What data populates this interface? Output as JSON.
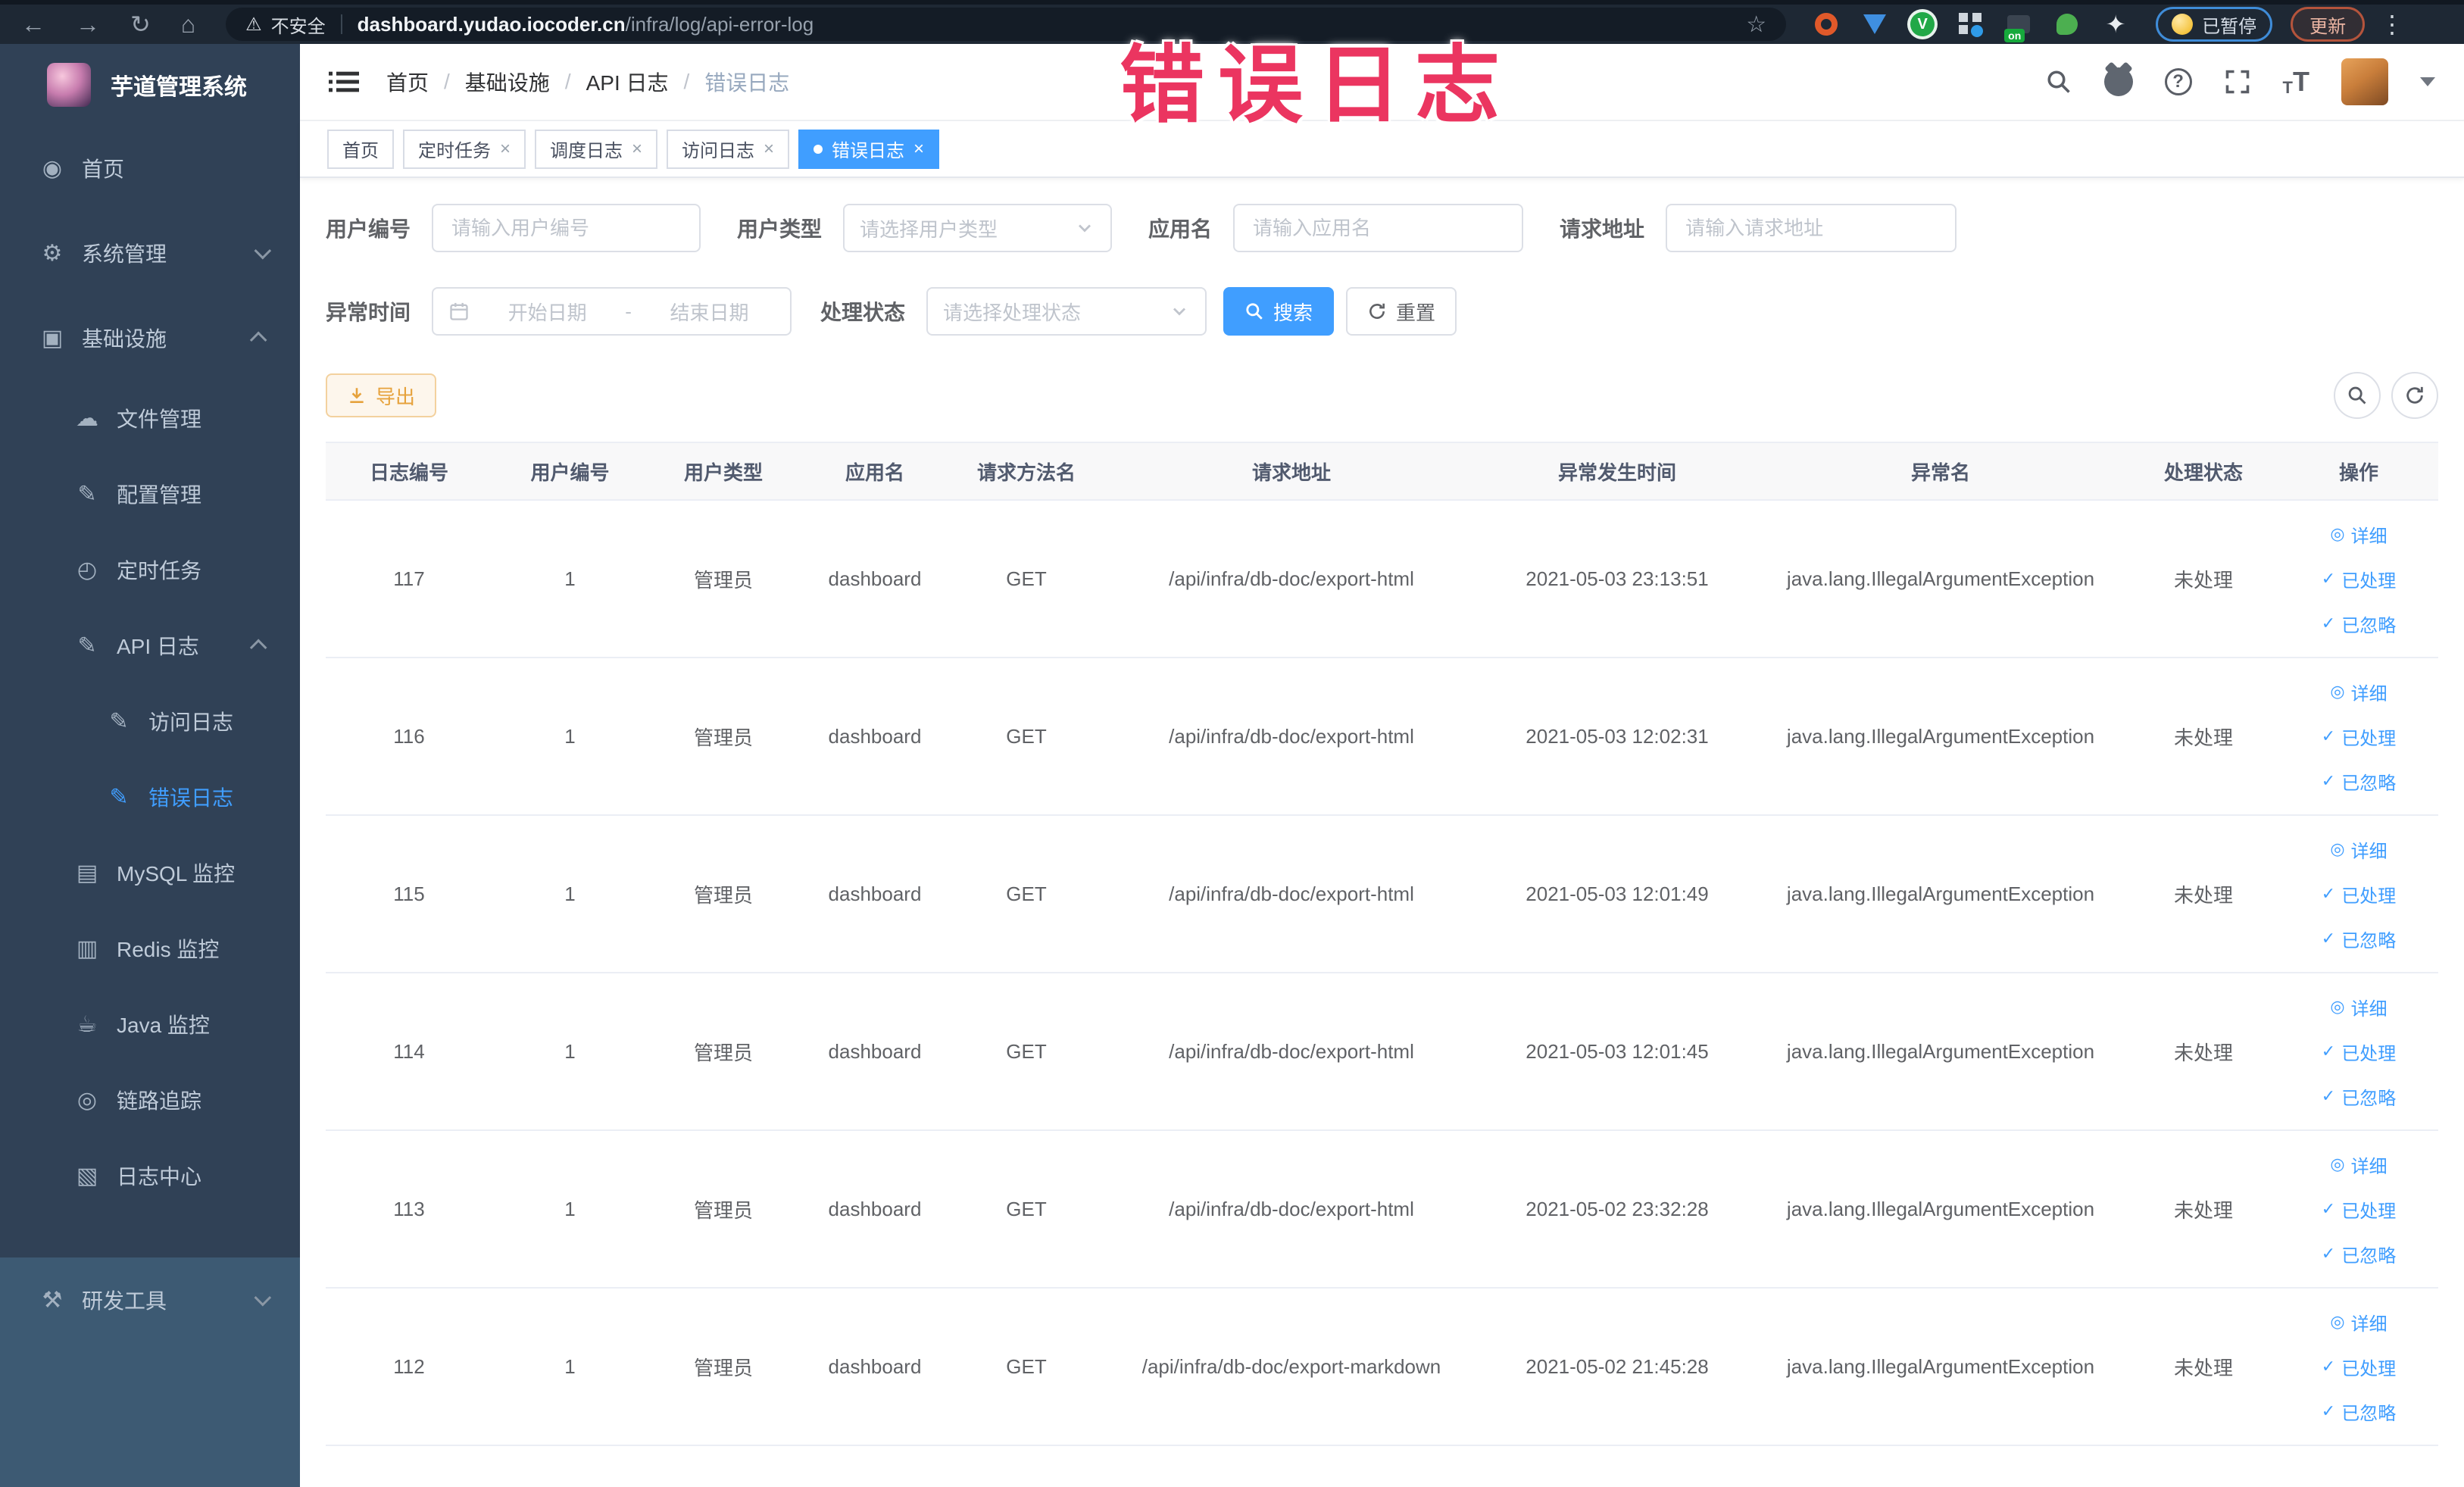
{
  "browser": {
    "security_label": "不安全",
    "url_domain": "dashboard.yudao.iocoder.cn",
    "url_path": "/infra/log/api-error-log",
    "paused_label": "已暂停",
    "update_label": "更新"
  },
  "overlay_title": "错误日志",
  "glyphs": {
    "back": "←",
    "forward": "→",
    "reload": "↻",
    "home": "⌂",
    "warning": "⚠",
    "star": "☆",
    "dots": "⋮",
    "check": "✓",
    "detail": "◎",
    "v": "V",
    "menu_dashboard": "◉",
    "menu_gear": "⚙",
    "menu_monitor": "▣",
    "menu_cloud": "☁",
    "menu_edit": "✎",
    "menu_timer": "◴",
    "menu_log": "✎",
    "menu_doc": "✎",
    "menu_mysql": "▤",
    "menu_redis": "▥",
    "menu_java": "☕",
    "menu_trace": "◎",
    "menu_logcenter": "▧",
    "menu_tools": "⚒"
  },
  "sidebar": {
    "app_title": "芋道管理系统",
    "items": [
      {
        "label": "首页"
      },
      {
        "label": "系统管理"
      },
      {
        "label": "基础设施"
      },
      {
        "label": "文件管理"
      },
      {
        "label": "配置管理"
      },
      {
        "label": "定时任务"
      },
      {
        "label": "API 日志"
      },
      {
        "label": "访问日志"
      },
      {
        "label": "错误日志"
      },
      {
        "label": "MySQL 监控"
      },
      {
        "label": "Redis 监控"
      },
      {
        "label": "Java 监控"
      },
      {
        "label": "链路追踪"
      },
      {
        "label": "日志中心"
      },
      {
        "label": "研发工具"
      }
    ]
  },
  "breadcrumb": {
    "separator": "/",
    "items": [
      "首页",
      "基础设施",
      "API 日志",
      "错误日志"
    ]
  },
  "tabs": [
    {
      "label": "首页"
    },
    {
      "label": "定时任务"
    },
    {
      "label": "调度日志"
    },
    {
      "label": "访问日志"
    },
    {
      "label": "错误日志"
    }
  ],
  "filters": {
    "user_id_label": "用户编号",
    "user_id_placeholder": "请输入用户编号",
    "user_type_label": "用户类型",
    "user_type_placeholder": "请选择用户类型",
    "app_name_label": "应用名",
    "app_name_placeholder": "请输入应用名",
    "request_url_label": "请求地址",
    "request_url_placeholder": "请输入请求地址",
    "exception_time_label": "异常时间",
    "date_start_placeholder": "开始日期",
    "date_separator": "-",
    "date_end_placeholder": "结束日期",
    "process_status_label": "处理状态",
    "process_status_placeholder": "请选择处理状态",
    "search_label": "搜索",
    "reset_label": "重置"
  },
  "toolbar": {
    "export_label": "导出"
  },
  "table": {
    "columns": [
      "日志编号",
      "用户编号",
      "用户类型",
      "应用名",
      "请求方法名",
      "请求地址",
      "异常发生时间",
      "异常名",
      "处理状态",
      "操作"
    ],
    "action_labels": {
      "detail": "详细",
      "processed": "已处理",
      "ignored": "已忽略"
    },
    "rows": [
      {
        "id": "117",
        "user_id": "1",
        "user_type": "管理员",
        "app_name": "dashboard",
        "method": "GET",
        "url": "/api/infra/db-doc/export-html",
        "time": "2021-05-03 23:13:51",
        "exception": "java.lang.IllegalArgumentException",
        "status": "未处理"
      },
      {
        "id": "116",
        "user_id": "1",
        "user_type": "管理员",
        "app_name": "dashboard",
        "method": "GET",
        "url": "/api/infra/db-doc/export-html",
        "time": "2021-05-03 12:02:31",
        "exception": "java.lang.IllegalArgumentException",
        "status": "未处理"
      },
      {
        "id": "115",
        "user_id": "1",
        "user_type": "管理员",
        "app_name": "dashboard",
        "method": "GET",
        "url": "/api/infra/db-doc/export-html",
        "time": "2021-05-03 12:01:49",
        "exception": "java.lang.IllegalArgumentException",
        "status": "未处理"
      },
      {
        "id": "114",
        "user_id": "1",
        "user_type": "管理员",
        "app_name": "dashboard",
        "method": "GET",
        "url": "/api/infra/db-doc/export-html",
        "time": "2021-05-03 12:01:45",
        "exception": "java.lang.IllegalArgumentException",
        "status": "未处理"
      },
      {
        "id": "113",
        "user_id": "1",
        "user_type": "管理员",
        "app_name": "dashboard",
        "method": "GET",
        "url": "/api/infra/db-doc/export-html",
        "time": "2021-05-02 23:32:28",
        "exception": "java.lang.IllegalArgumentException",
        "status": "未处理"
      },
      {
        "id": "112",
        "user_id": "1",
        "user_type": "管理员",
        "app_name": "dashboard",
        "method": "GET",
        "url": "/api/infra/db-doc/export-markdown",
        "time": "2021-05-02 21:45:28",
        "exception": "java.lang.IllegalArgumentException",
        "status": "未处理"
      }
    ]
  },
  "colors": {
    "accent": "#409eff",
    "warning": "#e6a23c",
    "overlay_pink": "#eb3560",
    "sidebar_bg": "#304156",
    "sidebar_bottom_bg": "#3d5a73"
  }
}
